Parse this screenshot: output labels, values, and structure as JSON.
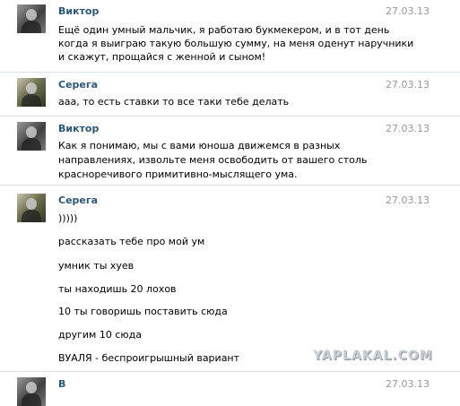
{
  "messages": [
    {
      "author": "Виктор",
      "date": "27.03.13",
      "lines": [
        "Ещё один умный мальчик, я работаю букмекером, и в тот день",
        "когда я выиграю такую большую сумму, на меня оденут наручники",
        "и скажут, прощайся с женной и сыном!"
      ]
    },
    {
      "author": "Серега",
      "date": "27.03.13",
      "lines": [
        "ааа, то есть ставки то все таки тебе делать"
      ]
    },
    {
      "author": "Виктор",
      "date": "27.03.13",
      "lines": [
        "Как я понимаю, мы с вами юноша движемся в разных",
        "направлениях, извольте меня освободить от вашего столь",
        "красноречивого примитивно-мыслящего ума."
      ]
    },
    {
      "author": "Серега",
      "date": "27.03.13",
      "lines": [
        ")))))",
        "рассказать тебе про мой ум",
        "умник ты хуев",
        "ты находишь 20 лохов",
        "10 ты говоришь поставить сюда",
        "другим 10 сюда",
        "ВУАЛЯ - беспроигрышный вариант"
      ]
    },
    {
      "author": "В",
      "date": "27.03.13"
    }
  ],
  "watermark": "YAPLAKAL.COM",
  "colors": {
    "author": "#2b587a",
    "date": "#999999",
    "separator": "#dae1e8"
  }
}
